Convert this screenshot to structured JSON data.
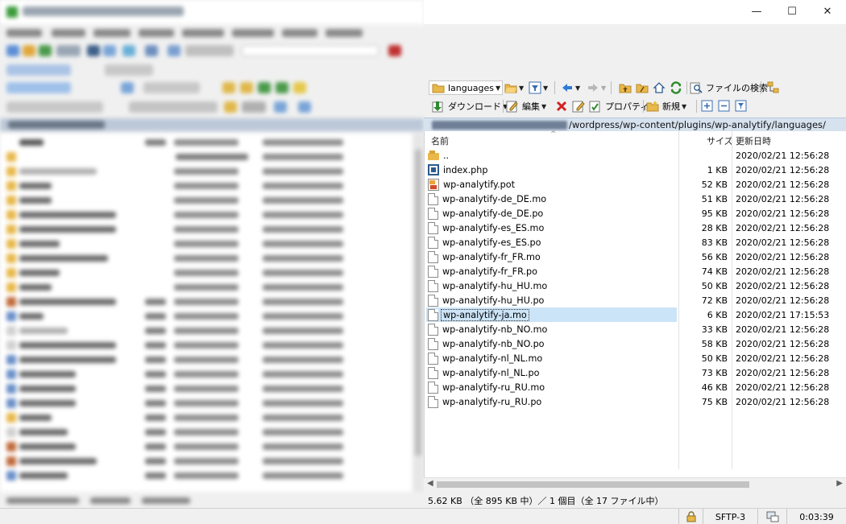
{
  "window": {
    "minimize_glyph": "—",
    "maximize_glyph": "☐",
    "close_glyph": "✕"
  },
  "toolbar_nav": {
    "folder_select": "languages",
    "find_files_label": "ファイルの検索"
  },
  "toolbar_actions": {
    "download_label": "ダウンロード",
    "edit_label": "編集",
    "properties_label": "プロパティ",
    "new_label": "新規"
  },
  "path": {
    "visible_text": "/wordpress/wp-content/plugins/wp-analytify/languages/"
  },
  "columns": {
    "name": "名前",
    "size": "サイズ",
    "modified": "更新日時"
  },
  "files": [
    {
      "name": "..",
      "size": "",
      "modified": "2020/02/21 12:56:28",
      "icon": "parent-folder-icon"
    },
    {
      "name": "index.php",
      "size": "1 KB",
      "modified": "2020/02/21 12:56:28",
      "icon": "php-file-icon"
    },
    {
      "name": "wp-analytify.pot",
      "size": "52 KB",
      "modified": "2020/02/21 12:56:28",
      "icon": "pot-file-icon"
    },
    {
      "name": "wp-analytify-de_DE.mo",
      "size": "51 KB",
      "modified": "2020/02/21 12:56:28",
      "icon": "file-icon"
    },
    {
      "name": "wp-analytify-de_DE.po",
      "size": "95 KB",
      "modified": "2020/02/21 12:56:28",
      "icon": "file-icon"
    },
    {
      "name": "wp-analytify-es_ES.mo",
      "size": "28 KB",
      "modified": "2020/02/21 12:56:28",
      "icon": "file-icon"
    },
    {
      "name": "wp-analytify-es_ES.po",
      "size": "83 KB",
      "modified": "2020/02/21 12:56:28",
      "icon": "file-icon"
    },
    {
      "name": "wp-analytify-fr_FR.mo",
      "size": "56 KB",
      "modified": "2020/02/21 12:56:28",
      "icon": "file-icon"
    },
    {
      "name": "wp-analytify-fr_FR.po",
      "size": "74 KB",
      "modified": "2020/02/21 12:56:28",
      "icon": "file-icon"
    },
    {
      "name": "wp-analytify-hu_HU.mo",
      "size": "50 KB",
      "modified": "2020/02/21 12:56:28",
      "icon": "file-icon"
    },
    {
      "name": "wp-analytify-hu_HU.po",
      "size": "72 KB",
      "modified": "2020/02/21 12:56:28",
      "icon": "file-icon"
    },
    {
      "name": "wp-analytify-ja.mo",
      "size": "6 KB",
      "modified": "2020/02/21 17:15:53",
      "icon": "file-icon",
      "selected": true
    },
    {
      "name": "wp-analytify-nb_NO.mo",
      "size": "33 KB",
      "modified": "2020/02/21 12:56:28",
      "icon": "file-icon"
    },
    {
      "name": "wp-analytify-nb_NO.po",
      "size": "58 KB",
      "modified": "2020/02/21 12:56:28",
      "icon": "file-icon"
    },
    {
      "name": "wp-analytify-nl_NL.mo",
      "size": "50 KB",
      "modified": "2020/02/21 12:56:28",
      "icon": "file-icon"
    },
    {
      "name": "wp-analytify-nl_NL.po",
      "size": "73 KB",
      "modified": "2020/02/21 12:56:28",
      "icon": "file-icon"
    },
    {
      "name": "wp-analytify-ru_RU.mo",
      "size": "46 KB",
      "modified": "2020/02/21 12:56:28",
      "icon": "file-icon"
    },
    {
      "name": "wp-analytify-ru_RU.po",
      "size": "75 KB",
      "modified": "2020/02/21 12:56:28",
      "icon": "file-icon"
    }
  ],
  "panel_status": "5.62 KB （全 895 KB 中）／ 1 個目（全 17 ファイル中）",
  "main_status": {
    "protocol": "SFTP-3",
    "elapsed": "0:03:39"
  },
  "colors": {
    "selection": "#cce4f7",
    "path_bar": "#d7e2ef",
    "accent_green": "#2e8b2e",
    "delete_red": "#d22222"
  }
}
